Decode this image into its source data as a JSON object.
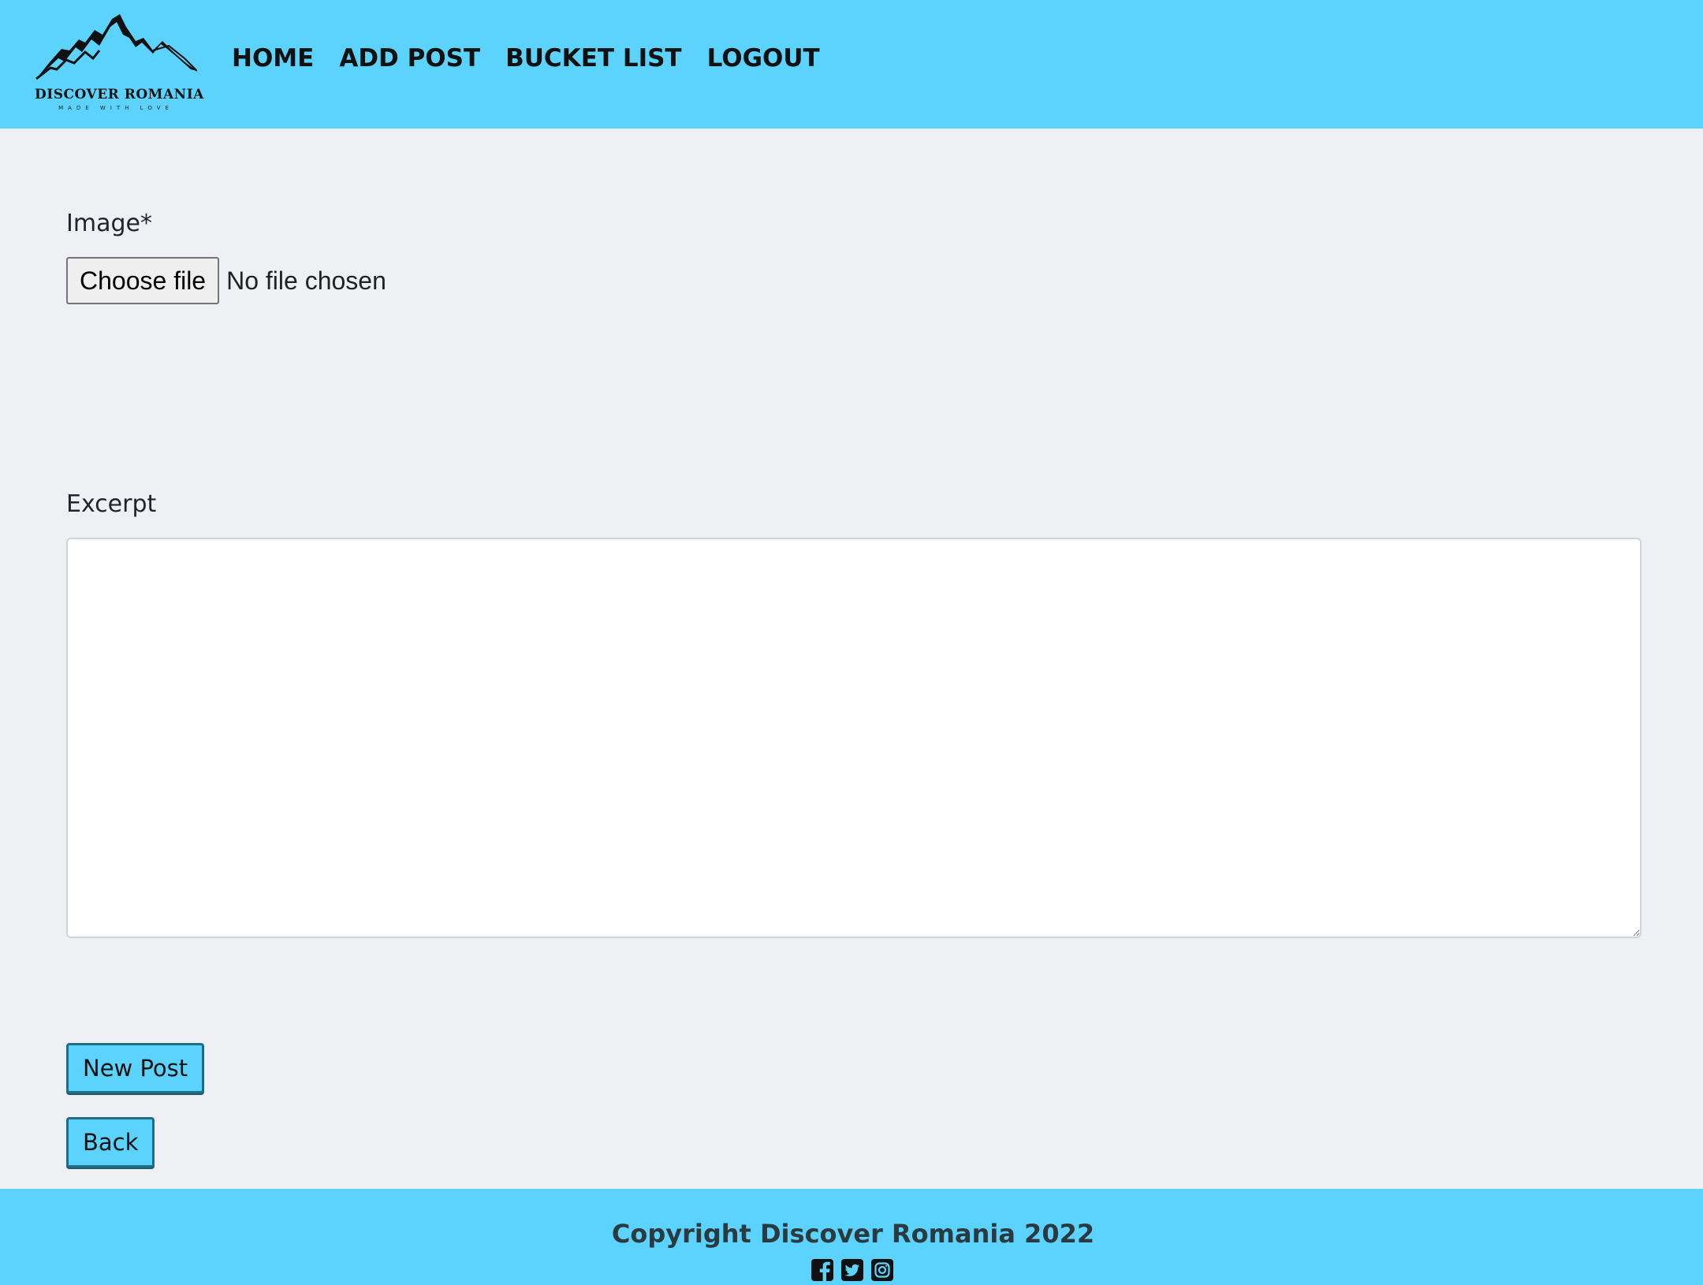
{
  "brand": {
    "title": "DISCOVER ROMANIA",
    "subtitle": "MADE WITH LOVE",
    "icon": "mountain-logo"
  },
  "nav": {
    "items": [
      {
        "label": "HOME"
      },
      {
        "label": "ADD POST"
      },
      {
        "label": "BUCKET LIST"
      },
      {
        "label": "LOGOUT"
      }
    ]
  },
  "form": {
    "image_label": "Image*",
    "choose_file_label": "Choose file",
    "file_status": "No file chosen",
    "excerpt_label": "Excerpt",
    "excerpt_value": "",
    "submit_label": "New Post",
    "back_label": "Back"
  },
  "footer": {
    "copyright": "Copyright Discover Romania 2022",
    "social_icons": [
      "facebook-icon",
      "twitter-icon",
      "instagram-icon"
    ]
  },
  "colors": {
    "header_bg": "#5bd3fc",
    "page_bg": "#eff0f4",
    "button_bg": "#5bd3fc",
    "button_border": "#1f6f84"
  }
}
